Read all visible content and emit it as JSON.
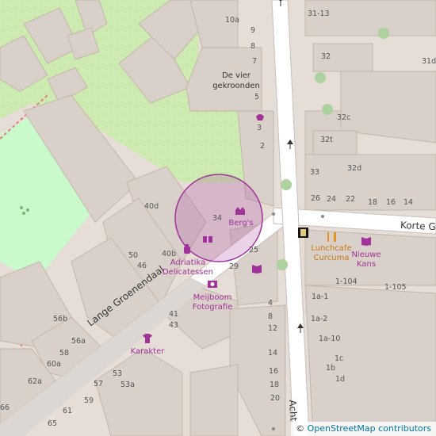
{
  "map": {
    "streets": {
      "lange_groenendaal": "Lange Groenendaal",
      "korte": "Korte G",
      "achter": "Acht"
    },
    "pois": {
      "bergs": "Berg's",
      "adriatika_l1": "Adriatika",
      "adriatika_l2": "Delicatessen",
      "meijboom_l1": "Meijboom",
      "meijboom_l2": "Fotografie",
      "karakter": "Karakter",
      "lunchcafe_l1": "Lunchcafe",
      "lunchcafe_l2": "Curcuma",
      "nieuwe_l1": "Nieuwe",
      "nieuwe_l2": "Kans",
      "devier_l1": "De vier",
      "devier_l2": "gekroonden"
    },
    "house_numbers": {
      "h10a": "10a",
      "h9": "9",
      "h8": "8",
      "h7": "7",
      "h5": "5",
      "h3": "3",
      "h2": "2",
      "h31_13": "31-13",
      "h32": "32",
      "h31d": "31d",
      "h32c": "32c",
      "h32t": "32t",
      "h32d": "32d",
      "h33": "33",
      "h26": "26",
      "h24": "24",
      "h22": "22",
      "h18": "18",
      "h16": "16",
      "h14": "14",
      "h40d": "40d",
      "h34": "34",
      "h50": "50",
      "h46": "46",
      "h40b": "40b",
      "h25": "25",
      "h29": "29",
      "h4": "4",
      "h8b": "8",
      "h12": "12",
      "h14b": "14",
      "h16b": "16",
      "h18b": "18",
      "h20": "20",
      "h41": "41",
      "h43": "43",
      "h56b": "56b",
      "h56a": "56a",
      "h58": "58",
      "h60a": "60a",
      "h62a": "62a",
      "h53": "53",
      "h53a": "53a",
      "h57": "57",
      "h59": "59",
      "h61": "61",
      "h65": "65",
      "h66": "66",
      "h1_104": "1-104",
      "h1_105": "1-105",
      "h1a1": "1a-1",
      "h1a2": "1a-2",
      "h1a10": "1a-10",
      "h1c": "1c",
      "h1b": "1b",
      "h1d": "1d"
    },
    "attribution_symbol": "©",
    "attribution_link": "OpenStreetMap contributors",
    "colors": {
      "background": "#d9d0c9",
      "park": "#c8facc",
      "grass": "#cdebb0",
      "building": "#d9d0c9",
      "road": "#ffffff",
      "poi": "#a0339a",
      "highlight": "#a0339a"
    }
  }
}
